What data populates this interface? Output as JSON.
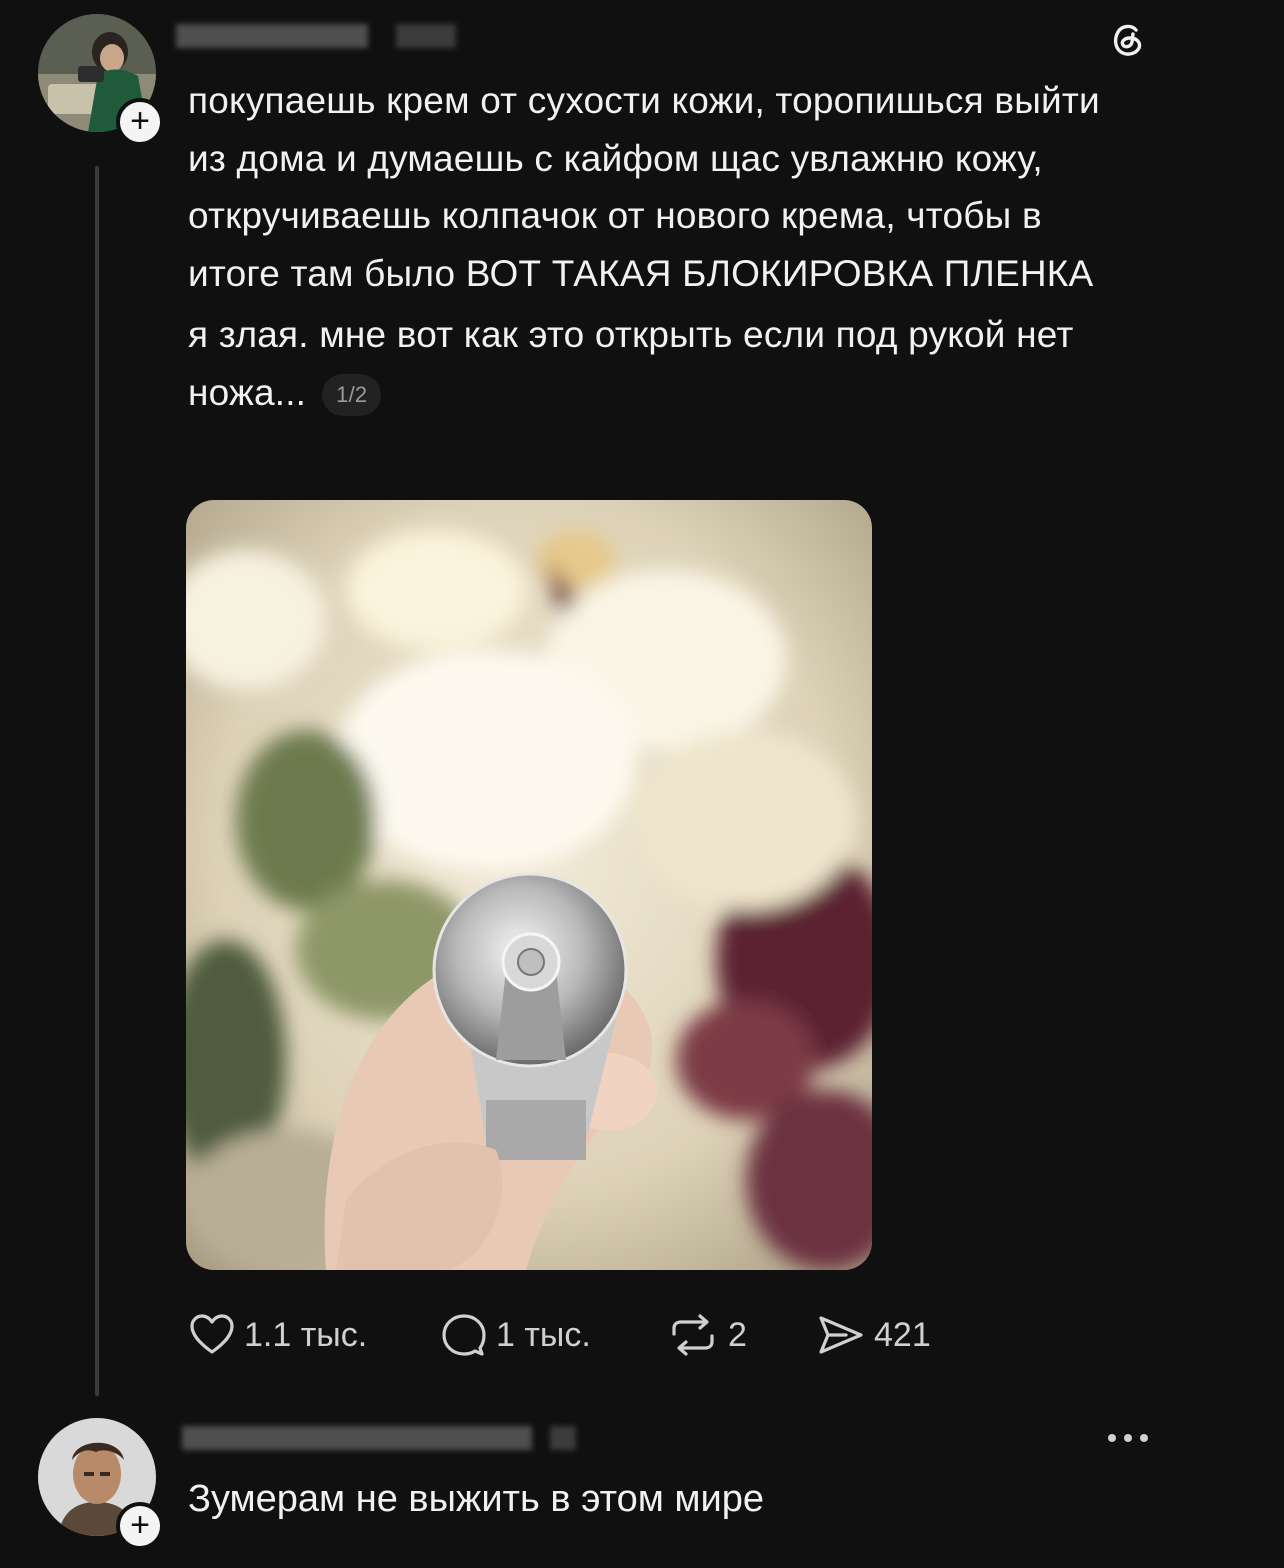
{
  "post": {
    "text_part1": "покупаешь крем от сухости кожи, торопишься выйти из дома и думаешь с кайфом щас увлажню кожу, откручиваешь колпачок от нового крема, чтобы в итоге там было ВОТ ТАКАЯ БЛОКИРОВКА ПЛЕНКА",
    "text_part2": "я злая. мне вот как это открыть если под рукой нет ножа...",
    "page_counter": "1/2",
    "likes": "1.1 тыс.",
    "comments": "1 тыс.",
    "reposts": "2",
    "shares": "421"
  },
  "reply": {
    "text": "Зумерам не выжить в этом мире"
  },
  "icons": {
    "app": "threads-icon",
    "like": "heart-icon",
    "comment": "comment-bubble-icon",
    "repost": "repost-icon",
    "share": "send-icon",
    "more": "more-dots-icon",
    "follow": "plus-icon"
  },
  "colors": {
    "background": "#101010",
    "text": "#f1f1f1",
    "muted": "#9a9a9a"
  }
}
